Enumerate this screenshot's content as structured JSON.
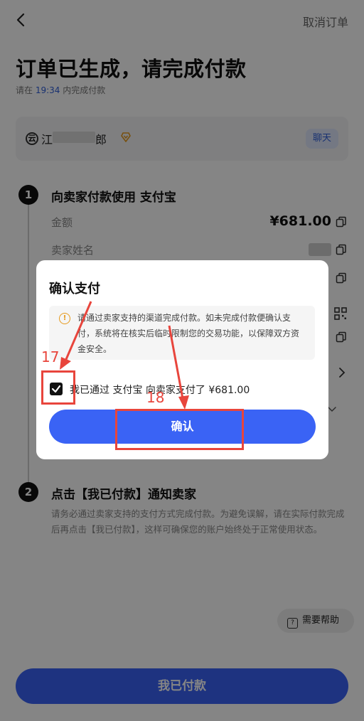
{
  "header": {
    "cancel_label": "取消订单",
    "title": "订单已生成，请完成付款",
    "deadline_prefix": "请在",
    "deadline_time": "19:34",
    "deadline_suffix": "内完成付款"
  },
  "seller": {
    "avatar_char": "云",
    "name_prefix": "江",
    "name_suffix": "郎",
    "chat_label": "聊天"
  },
  "steps": {
    "step1": {
      "number": "1",
      "title": "向卖家付款使用 支付宝",
      "amount_label": "金额",
      "amount_value": "¥681.00",
      "seller_name_label": "卖家姓名"
    },
    "step2": {
      "number": "2",
      "title": "点击【我已付款】通知卖家",
      "description": "请务必通过卖家支持的支付方式完成付款。为避免误解，请在实际付款完成后再点击【我已付款】，这样可确保您的账户始终处于正常使用状态。"
    }
  },
  "help_label": "需要帮助",
  "paid_button_label": "我已付款",
  "dialog": {
    "title": "确认支付",
    "notice": "请通过卖家支持的渠道完成付款。如未完成付款便确认支付，系统将在核实后临时限制您的交易功能，以保障双方资金安全。",
    "checkbox_label": "我已通过 支付宝 向卖家支付了 ¥681.00",
    "checkbox_checked": true,
    "confirm_label": "确认"
  },
  "annotations": {
    "label_17": "17",
    "label_18": "18",
    "color": "#e8453c"
  },
  "colors": {
    "primary": "#3a63f5",
    "link": "#2f5fd8",
    "warning": "#e69a1e"
  }
}
